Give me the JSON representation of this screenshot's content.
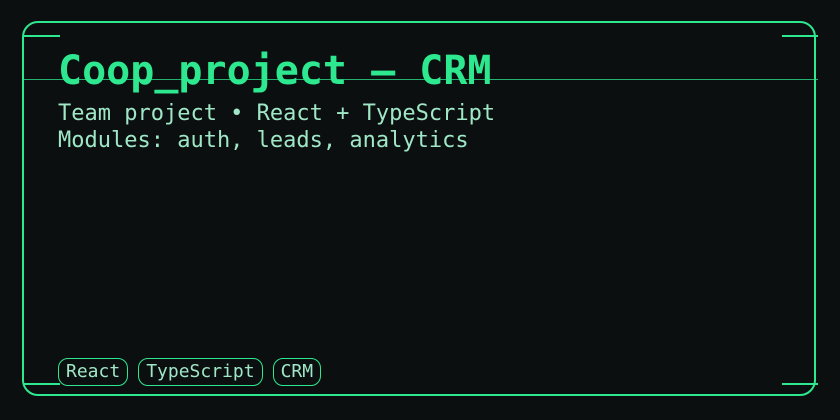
{
  "card": {
    "title": "Coop_project — CRM",
    "subtitle": "Team project • React + TypeScript",
    "modules": "Modules: auth, leads, analytics",
    "tags": [
      "React",
      "TypeScript",
      "CRM"
    ]
  },
  "colors": {
    "background": "#0b0f10",
    "accent": "#2ee88f",
    "text": "#9fe7c6"
  }
}
